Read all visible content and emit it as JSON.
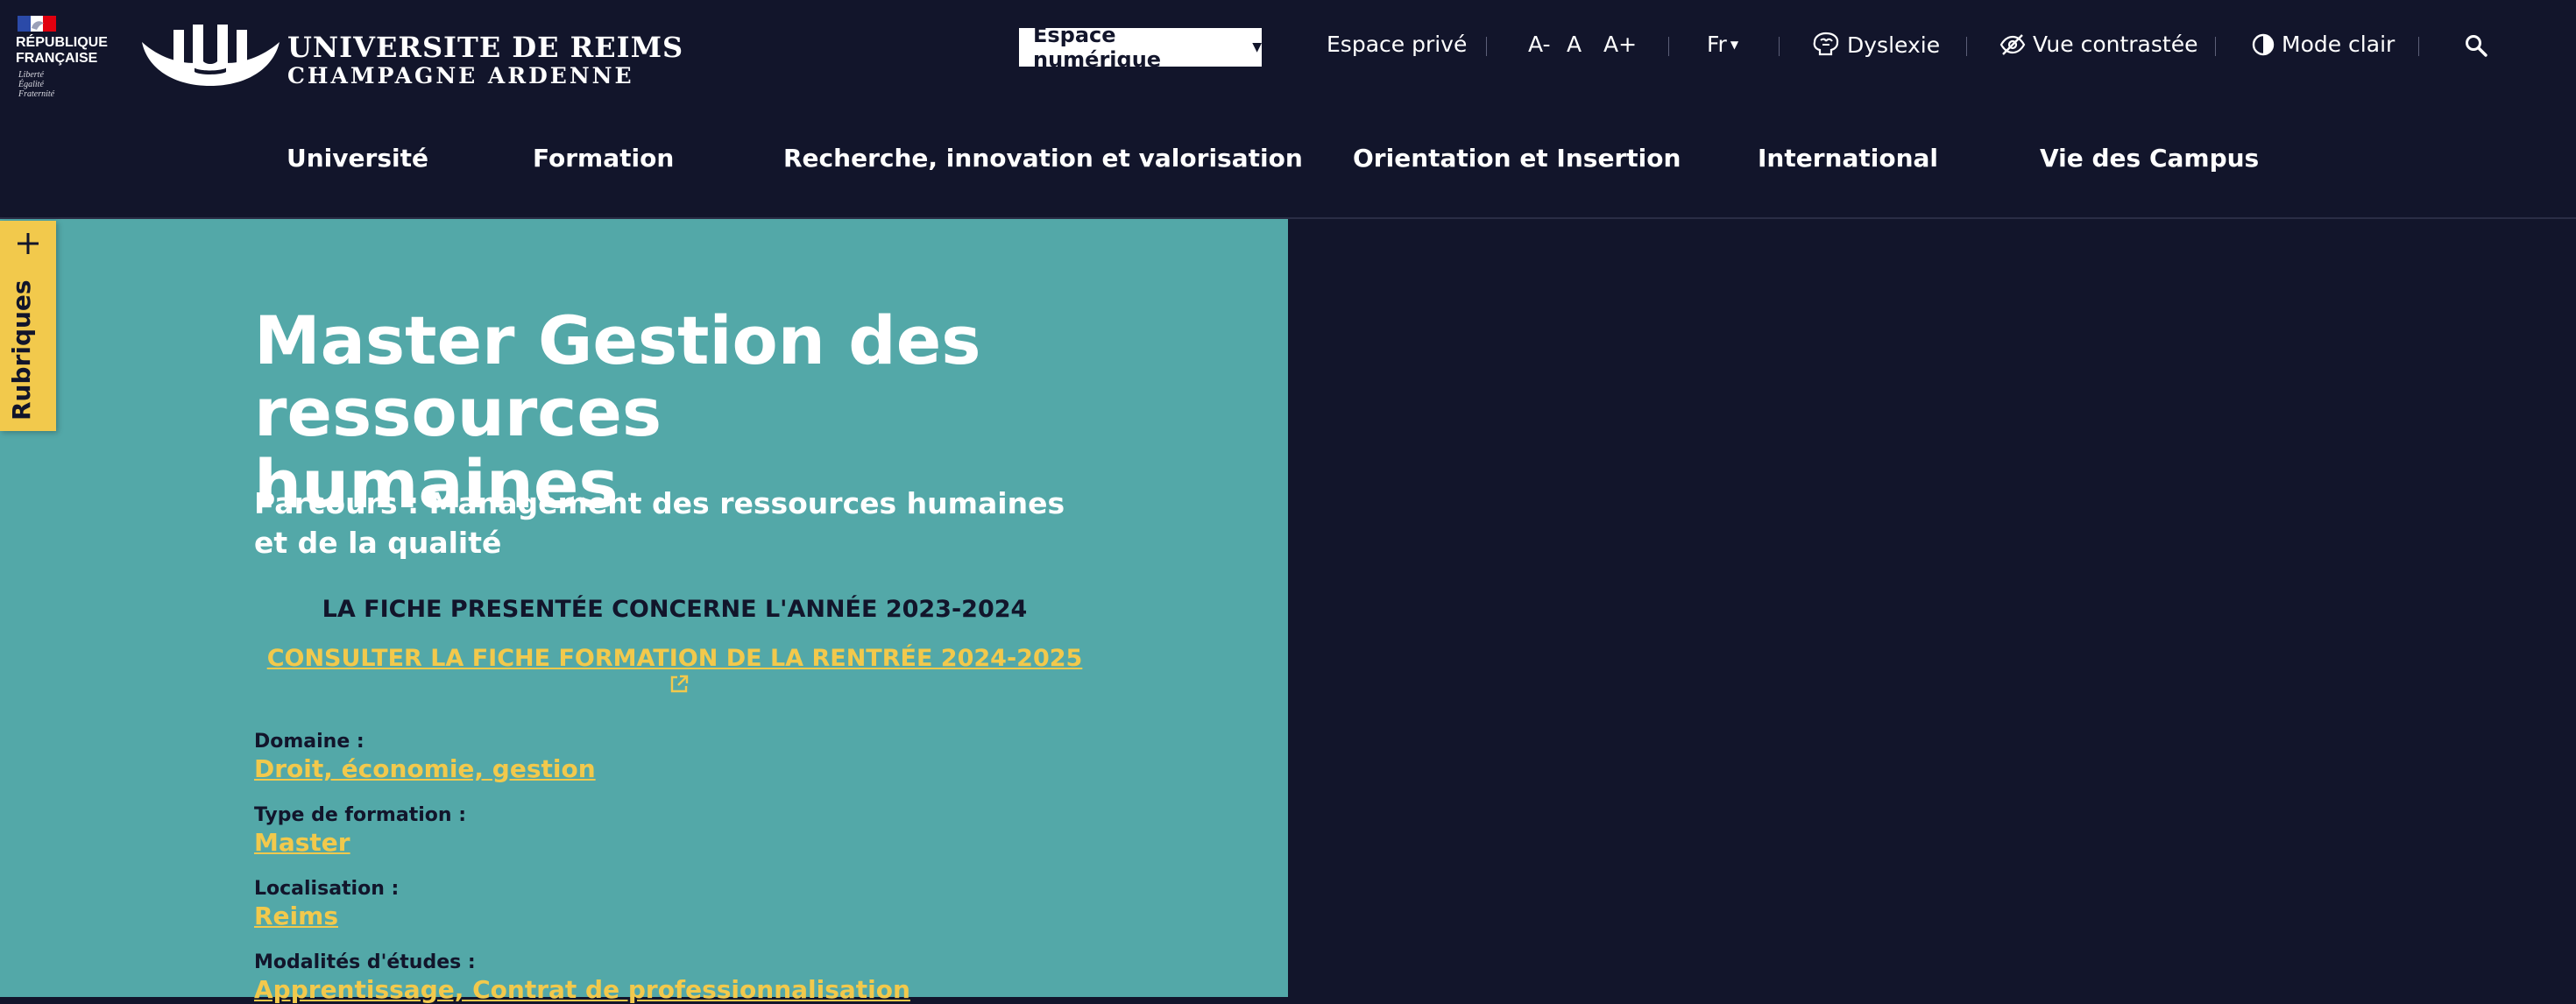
{
  "header": {
    "republique": {
      "name": "RÉPUBLIQUE\nFRANÇAISE",
      "motto": "Liberté\nÉgalité\nFraternité"
    },
    "university": {
      "line1": "UNIVERSITE DE REIMS",
      "line2": "CHAMPAGNE ARDENNE"
    },
    "espace_numerique": "Espace numérique",
    "espace_prive": "Espace privé",
    "font_small": "A-",
    "font_normal": "A",
    "font_large": "A+",
    "language": "Fr",
    "dyslexie": "Dyslexie",
    "vue_contrastee": "Vue contrastée",
    "mode_clair": "Mode clair"
  },
  "nav": {
    "items": [
      "Université",
      "Formation",
      "Recherche, innovation et valorisation",
      "Orientation et Insertion",
      "International",
      "Vie des Campus"
    ]
  },
  "sidebar_tab": {
    "label": "Rubriques"
  },
  "content": {
    "title": "Master Gestion des ressources humaines",
    "subtitle": "Parcours : Management des ressources humaines et de la qualité",
    "fiche_note": "LA FICHE PRESENTÉE CONCERNE L'ANNÉE 2023-2024",
    "fiche_link": "CONSULTER LA FICHE FORMATION DE LA RENTRÉE 2024-2025",
    "fields": [
      {
        "label": "Domaine :",
        "value": "Droit, économie, gestion"
      },
      {
        "label": "Type de formation :",
        "value": "Master"
      },
      {
        "label": "Localisation :",
        "value": "Reims"
      },
      {
        "label": "Modalités d'études :",
        "value": "Apprentissage, Contrat de professionnalisation"
      }
    ]
  },
  "colors": {
    "header_bg": "#12152b",
    "panel_bg": "#53a8a8",
    "accent_yellow": "#f2c94c",
    "text_dark": "#12152b"
  }
}
